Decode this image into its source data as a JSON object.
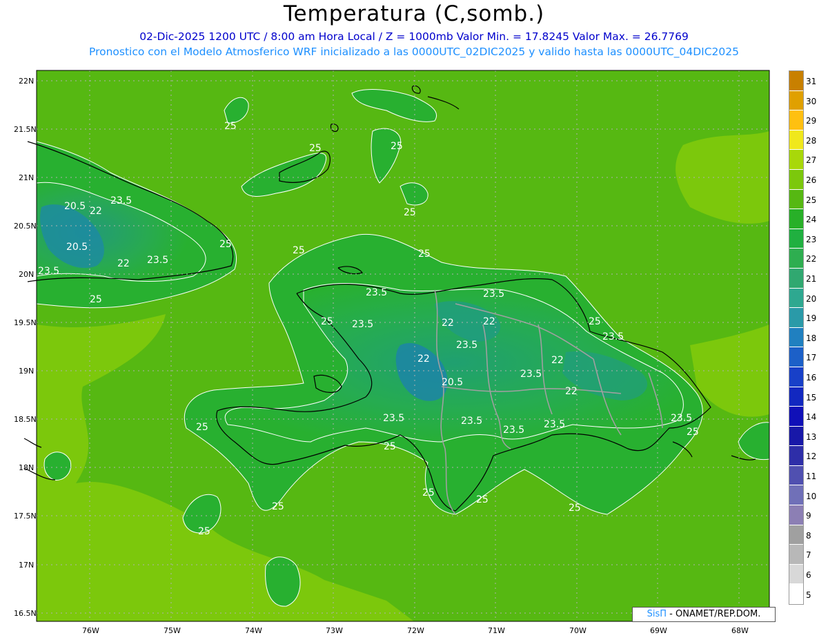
{
  "header": {
    "title": "Temperatura (C,somb.)",
    "line1": "02-Dic-2025  1200 UTC / 8:00 am Hora Local / Z = 1000mb   Valor Min. = 17.8245  Valor Max. = 26.7769",
    "line2": "Pronostico con el Modelo Atmosferico WRF inicializado a las 0000UTC_02DIC2025 y valido hasta las  0000UTC_04DIC2025"
  },
  "axes": {
    "lat_labels": [
      "22N",
      "21.5N",
      "21N",
      "20.5N",
      "20N",
      "19.5N",
      "19N",
      "18.5N",
      "18N",
      "17.5N",
      "17N",
      "16.5N"
    ],
    "lon_labels": [
      "76W",
      "75W",
      "74W",
      "73W",
      "72W",
      "71W",
      "70W",
      "69W",
      "68W"
    ]
  },
  "contour_labels": [
    "25",
    "25",
    "25",
    "25",
    "25",
    "25",
    "25",
    "25",
    "25",
    "25",
    "25",
    "25",
    "25",
    "25",
    "25",
    "25",
    "25",
    "25",
    "20.5",
    "22",
    "23.5",
    "20.5",
    "22",
    "23.5",
    "23.5",
    "23.5",
    "23.5",
    "22",
    "23.5",
    "22",
    "23.5",
    "22",
    "20.5",
    "23.5",
    "22",
    "23.5",
    "22",
    "23.5",
    "23.5",
    "23.5",
    "23.5",
    "23.5"
  ],
  "legend": {
    "values": [
      "5",
      "6",
      "7",
      "8",
      "9",
      "10",
      "11",
      "12",
      "13",
      "14",
      "15",
      "16",
      "17",
      "18",
      "19",
      "20",
      "21",
      "22",
      "23",
      "24",
      "25",
      "26",
      "27",
      "28",
      "29",
      "30",
      "31"
    ],
    "colors": [
      "#ffffff",
      "#d8d8d8",
      "#b8b8b8",
      "#a0a0a0",
      "#8c7fb4",
      "#7070b8",
      "#5050b0",
      "#2e2ea8",
      "#1818a8",
      "#1010b8",
      "#1228c0",
      "#1840c8",
      "#1c60c8",
      "#2080c0",
      "#2a9aa8",
      "#2ea890",
      "#30a870",
      "#2eae50",
      "#20b040",
      "#28b028",
      "#56b812",
      "#7cc80c",
      "#a8d80a",
      "#f0e81c",
      "#ffc010",
      "#e0a000",
      "#c88000"
    ]
  },
  "credit": {
    "brand": "SisΠ",
    "text": " - ONAMET/REP.DOM."
  }
}
